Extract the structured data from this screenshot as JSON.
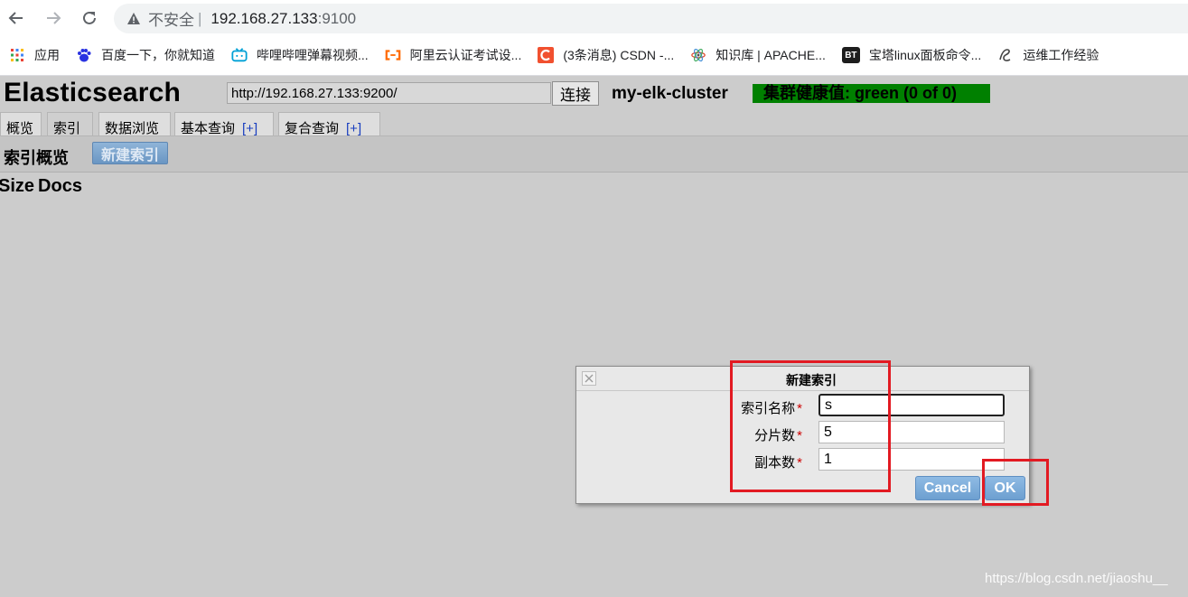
{
  "browser": {
    "insecure_label": "不安全",
    "separator": "|",
    "address_host": "192.168.27.133",
    "address_port": ":9100",
    "bookmarks": [
      {
        "label": "应用",
        "icon": "apps-grid-icon"
      },
      {
        "label": "百度一下，你就知道",
        "icon": "baidu-paw-icon"
      },
      {
        "label": "哔哩哔哩弹幕视频...",
        "icon": "bilibili-tv-icon"
      },
      {
        "label": "阿里云认证考试设...",
        "icon": "aliyun-icon"
      },
      {
        "label": "(3条消息) CSDN -...",
        "icon": "csdn-icon"
      },
      {
        "label": "知识库 | APACHE...",
        "icon": "atom-icon"
      },
      {
        "label": "宝塔linux面板命令...",
        "icon": "bt-icon",
        "icon_text": "BT"
      },
      {
        "label": "运维工作经验",
        "icon": "custom-logo-icon"
      }
    ]
  },
  "app": {
    "title": "Elasticsearch",
    "url_value": "http://192.168.27.133:9200/",
    "connect_label": "连接",
    "cluster_name": "my-elk-cluster",
    "health_text": "集群健康值: green (0 of 0)",
    "health_color": "#008000",
    "tabs": [
      {
        "label": "概览"
      },
      {
        "label": "索引"
      },
      {
        "label": "数据浏览"
      },
      {
        "label": "基本查询",
        "plus": "[+]"
      },
      {
        "label": "复合查询",
        "plus": "[+]"
      }
    ],
    "active_tab": "索引",
    "sub_title": "索引概览",
    "new_index_label": "新建索引",
    "columns": [
      "Size",
      "Docs"
    ]
  },
  "dialog": {
    "title": "新建索引",
    "fields": [
      {
        "label": "索引名称",
        "required": "*",
        "value": "s"
      },
      {
        "label": "分片数",
        "required": "*",
        "value": "5"
      },
      {
        "label": "副本数",
        "required": "*",
        "value": "1"
      }
    ],
    "cancel_label": "Cancel",
    "ok_label": "OK"
  },
  "watermark": "https://blog.csdn.net/jiaoshu__",
  "colors": {
    "accent_blue": "#6d9fd0",
    "highlight_red": "#e21a22",
    "page_bg": "#cccccc"
  }
}
